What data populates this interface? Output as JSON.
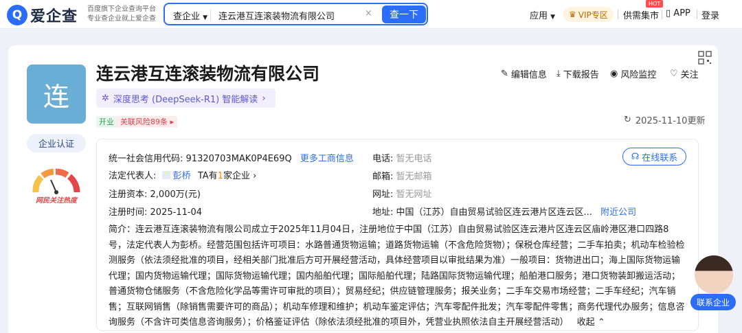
{
  "header": {
    "logo_mark": "Q",
    "logo_text": "爱企查",
    "slogan_line1": "百度旗下企业查询平台",
    "slogan_line2": "专业查企业就上爱企查",
    "search_type": "查企业",
    "search_value": "连云港互连滚装物流有限公司",
    "search_button": "查一下",
    "nav_app": "应用",
    "vip": "VIP专区",
    "hot_badge": "HOT",
    "supply": "供需集市",
    "app_download": "APP",
    "login": "登录"
  },
  "company": {
    "avatar_char": "连",
    "cert_label": "企业认证",
    "gauge_label": "网民关注热度",
    "name": "连云港互连滚装物流有限公司",
    "deepseek": "深度思考 (DeepSeek-R1) 智能解读",
    "status": "开业",
    "risk": "关联风险89条",
    "actions": {
      "edit": "编辑信息",
      "download": "下载报告",
      "monitor": "风险监控",
      "follow": "关注"
    },
    "updated": "2025-11-10更新"
  },
  "info": {
    "credit_label": "统一社会信用代码:",
    "credit_value": "91320703MAK0P4E69Q",
    "more_info": "更多工商信息",
    "legal_label": "法定代表人:",
    "legal_name": "彭桥",
    "legal_ta": "TA有",
    "legal_count": "1",
    "legal_suffix": "家企业",
    "capital_label": "注册资本:",
    "capital_value": "2,000万(元)",
    "date_label": "注册时间:",
    "date_value": "2025-11-04",
    "phone_label": "电话:",
    "phone_value": "暂无电话",
    "email_label": "邮箱:",
    "email_value": "暂无邮箱",
    "site_label": "网址:",
    "site_value": "暂无网址",
    "addr_label": "地址:",
    "addr_value": "中国（江苏）自由贸易试验区连云港片区连云区...",
    "nearby": "附近公司",
    "online_contact": "在线联系",
    "intro": "简介：连云港互连滚装物流有限公司成立于2025年11月04日，注册地位于中国（江苏）自由贸易试验区连云港片区连云区庙岭港区港口四路8号，法定代表人为彭桥。经营范围包括许可项目：水路普通货物运输；道路货物运输（不含危险货物）；保税仓库经营；二手车拍卖；机动车检验检测服务（依法须经批准的项目，经相关部门批准后方可开展经营活动，具体经营项目以审批结果为准）一般项目：货物进出口；海上国际货物运输代理；国内货物运输代理；国际货物运输代理；国内船舶代理；国际船舶代理；陆路国际货物运输代理；船舶港口服务；港口货物装卸搬运活动；普通货物仓储服务（不含危险化学品等需许可审批的项目）；贸易经纪；供应链管理服务；报关业务；二手车交易市场经营；二手车经纪；汽车销售；互联网销售（除销售需要许可的商品）；机动车修理和维护；机动车鉴定评估；汽车零配件批发；汽车零配件零售；商务代理代办服务；信息咨询服务（不含许可类信息咨询服务）；价格鉴证评估（除依法须经批准的项目外，凭营业执照依法自主开展经营活动）",
    "collapse": "收起"
  },
  "agent": {
    "button": "联系企业"
  },
  "colors": {
    "brand": "#2b6df6",
    "avatar_bg": "#6aaed6",
    "risk_red": "#e0404a",
    "open_green": "#2f9d52"
  }
}
